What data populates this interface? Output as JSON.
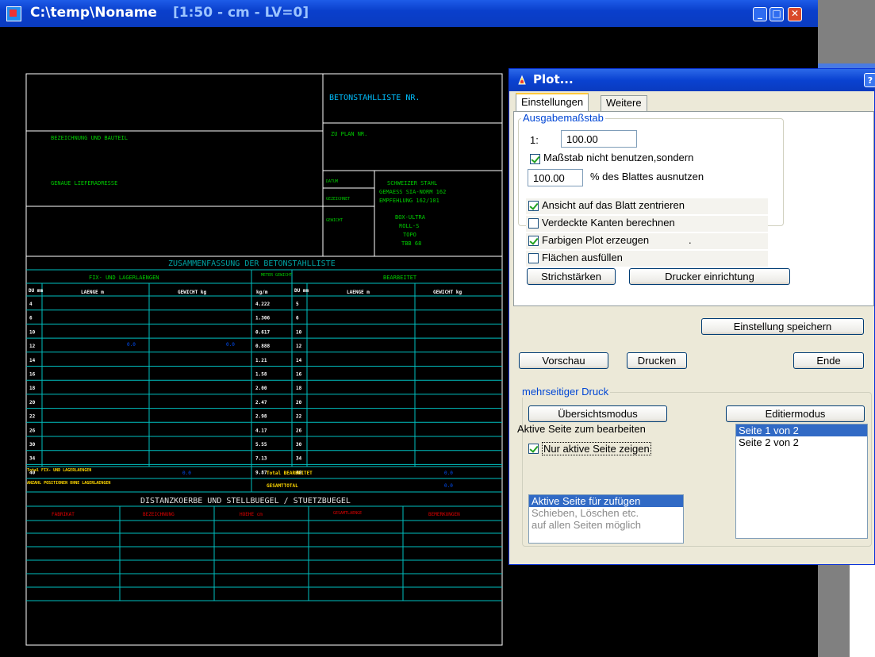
{
  "window": {
    "path": "C:\\temp\\Noname",
    "scale_info": "[1:50 - cm - LV=0]"
  },
  "drawing": {
    "title": "BETONSTAHLLISTE NR.",
    "plan_nr": "ZU PLAN NR.",
    "bezeichnung": "BEZEICHNUNG UND BAUTEIL",
    "lieferadresse": "GENAUE LIEFERADRESSE",
    "datum": "DATUM",
    "gezeichnet": "GEZEICHNET",
    "gewicht_label": "GEWICHT",
    "norm_lines": [
      "SCHWEIZER STAHL",
      "GEMAESS SIA-NORM 162",
      "EMPFEHLUNG 162/101"
    ],
    "stahl_types": [
      "BOX-ULTRA",
      "ROLL-S",
      "TOPO",
      "TBB 68"
    ],
    "summary_title": "ZUSAMMENFASSUNG DER BETONSTAHLLISTE",
    "left_header": "FIX- UND LAGERLAENGEN",
    "meter_header": "METER GEWICHT",
    "right_header": "BEARBEITET",
    "col_dm": "DU mm",
    "col_laenge": "LAENGE m",
    "col_gewicht": "GEWICHT kg",
    "col_kgm": "kg/m",
    "col_dm2": "DU mm",
    "col_laenge2": "LAENGE m",
    "col_gewicht2": "GEWICHT kg",
    "rows": [
      {
        "d": "4",
        "kgm": "4.222",
        "d2": "5"
      },
      {
        "d": "6",
        "kgm": "1.306",
        "d2": "6"
      },
      {
        "d": "10",
        "kgm": "0.617",
        "d2": "10"
      },
      {
        "d": "12",
        "kgm": "0.888",
        "d2": "12"
      },
      {
        "d": "14",
        "kgm": "1.21",
        "d2": "14"
      },
      {
        "d": "16",
        "kgm": "1.58",
        "d2": "16"
      },
      {
        "d": "18",
        "kgm": "2.00",
        "d2": "18"
      },
      {
        "d": "20",
        "kgm": "2.47",
        "d2": "20"
      },
      {
        "d": "22",
        "kgm": "2.98",
        "d2": "22"
      },
      {
        "d": "26",
        "kgm": "4.17",
        "d2": "26"
      },
      {
        "d": "30",
        "kgm": "5.55",
        "d2": "30"
      },
      {
        "d": "34",
        "kgm": "7.13",
        "d2": "34"
      },
      {
        "d": "40",
        "kgm": "9.87",
        "d2": "40"
      }
    ],
    "row12_marks": [
      "0.0",
      "0.0"
    ],
    "total_fix": "Total FIX- UND LAGERLAENGEN",
    "total_bearbeitet": "Total BEARBEITET",
    "anzahl": "ANZAHL POSITIONEN OHNE LAGERLAENGEN",
    "gesamttotal": "GESAMTTOTAL",
    "total_marks": [
      "0.0",
      "0.0",
      "0.0"
    ],
    "distanz_title": "DISTANZKOERBE UND STELLBUEGEL / STUETZBUEGEL",
    "distanz_cols": [
      "FABRIKAT",
      "BEZEICHNUNG",
      "HOEHE cm",
      "GESAMTLAENGE",
      "BEMERKUNGEN"
    ]
  },
  "dialog": {
    "title": "Plot...",
    "help": "?",
    "tabs": [
      "Einstellungen",
      "Weitere"
    ],
    "ausgabe": {
      "label": "Ausgabemaßstab",
      "ratio_prefix": "1:",
      "ratio_value": "100.00",
      "use_scale_label": "Maßstab nicht benutzen,sondern",
      "percent_value": "100.00",
      "percent_label": "% des Blattes ausnutzen"
    },
    "options": [
      {
        "label": "Ansicht auf das Blatt zentrieren",
        "checked": true
      },
      {
        "label": "Verdeckte Kanten berechnen",
        "checked": false
      },
      {
        "label": "Farbigen Plot erzeugen",
        "checked": true
      },
      {
        "label": "Flächen ausfüllen",
        "checked": false
      }
    ],
    "options_dot": ".",
    "btn_strich": "Strichstärken",
    "btn_drucker": "Drucker einrichtung",
    "btn_speichern": "Einstellung speichern",
    "btn_vorschau": "Vorschau",
    "btn_drucken": "Drucken",
    "btn_ende": "Ende",
    "multi": {
      "label": "mehrseitiger Druck",
      "btn_uebersicht": "Übersichtsmodus",
      "btn_editier": "Editiermodus",
      "aktive_label": "Aktive Seite zum bearbeiten",
      "nur_aktive": "Nur aktive Seite zeigen",
      "pages": [
        "Seite 1 von 2",
        "Seite 2 von 2"
      ],
      "info_lines": [
        "Aktive Seite für zufügen",
        "Schieben, Löschen etc.",
        "auf allen Seiten möglich"
      ]
    }
  }
}
